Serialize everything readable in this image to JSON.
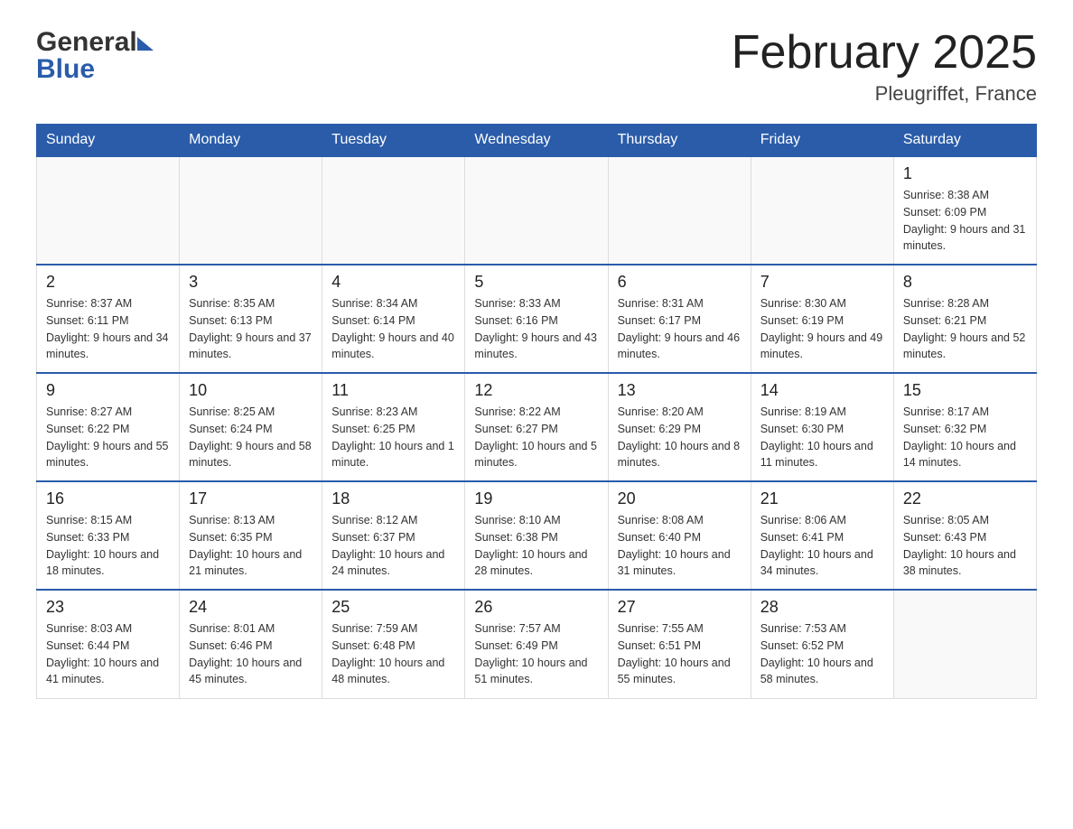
{
  "header": {
    "logo_general": "General",
    "logo_blue": "Blue",
    "month_title": "February 2025",
    "location": "Pleugriffet, France"
  },
  "days_of_week": [
    "Sunday",
    "Monday",
    "Tuesday",
    "Wednesday",
    "Thursday",
    "Friday",
    "Saturday"
  ],
  "weeks": [
    [
      {
        "day": "",
        "info": ""
      },
      {
        "day": "",
        "info": ""
      },
      {
        "day": "",
        "info": ""
      },
      {
        "day": "",
        "info": ""
      },
      {
        "day": "",
        "info": ""
      },
      {
        "day": "",
        "info": ""
      },
      {
        "day": "1",
        "info": "Sunrise: 8:38 AM\nSunset: 6:09 PM\nDaylight: 9 hours and 31 minutes."
      }
    ],
    [
      {
        "day": "2",
        "info": "Sunrise: 8:37 AM\nSunset: 6:11 PM\nDaylight: 9 hours and 34 minutes."
      },
      {
        "day": "3",
        "info": "Sunrise: 8:35 AM\nSunset: 6:13 PM\nDaylight: 9 hours and 37 minutes."
      },
      {
        "day": "4",
        "info": "Sunrise: 8:34 AM\nSunset: 6:14 PM\nDaylight: 9 hours and 40 minutes."
      },
      {
        "day": "5",
        "info": "Sunrise: 8:33 AM\nSunset: 6:16 PM\nDaylight: 9 hours and 43 minutes."
      },
      {
        "day": "6",
        "info": "Sunrise: 8:31 AM\nSunset: 6:17 PM\nDaylight: 9 hours and 46 minutes."
      },
      {
        "day": "7",
        "info": "Sunrise: 8:30 AM\nSunset: 6:19 PM\nDaylight: 9 hours and 49 minutes."
      },
      {
        "day": "8",
        "info": "Sunrise: 8:28 AM\nSunset: 6:21 PM\nDaylight: 9 hours and 52 minutes."
      }
    ],
    [
      {
        "day": "9",
        "info": "Sunrise: 8:27 AM\nSunset: 6:22 PM\nDaylight: 9 hours and 55 minutes."
      },
      {
        "day": "10",
        "info": "Sunrise: 8:25 AM\nSunset: 6:24 PM\nDaylight: 9 hours and 58 minutes."
      },
      {
        "day": "11",
        "info": "Sunrise: 8:23 AM\nSunset: 6:25 PM\nDaylight: 10 hours and 1 minute."
      },
      {
        "day": "12",
        "info": "Sunrise: 8:22 AM\nSunset: 6:27 PM\nDaylight: 10 hours and 5 minutes."
      },
      {
        "day": "13",
        "info": "Sunrise: 8:20 AM\nSunset: 6:29 PM\nDaylight: 10 hours and 8 minutes."
      },
      {
        "day": "14",
        "info": "Sunrise: 8:19 AM\nSunset: 6:30 PM\nDaylight: 10 hours and 11 minutes."
      },
      {
        "day": "15",
        "info": "Sunrise: 8:17 AM\nSunset: 6:32 PM\nDaylight: 10 hours and 14 minutes."
      }
    ],
    [
      {
        "day": "16",
        "info": "Sunrise: 8:15 AM\nSunset: 6:33 PM\nDaylight: 10 hours and 18 minutes."
      },
      {
        "day": "17",
        "info": "Sunrise: 8:13 AM\nSunset: 6:35 PM\nDaylight: 10 hours and 21 minutes."
      },
      {
        "day": "18",
        "info": "Sunrise: 8:12 AM\nSunset: 6:37 PM\nDaylight: 10 hours and 24 minutes."
      },
      {
        "day": "19",
        "info": "Sunrise: 8:10 AM\nSunset: 6:38 PM\nDaylight: 10 hours and 28 minutes."
      },
      {
        "day": "20",
        "info": "Sunrise: 8:08 AM\nSunset: 6:40 PM\nDaylight: 10 hours and 31 minutes."
      },
      {
        "day": "21",
        "info": "Sunrise: 8:06 AM\nSunset: 6:41 PM\nDaylight: 10 hours and 34 minutes."
      },
      {
        "day": "22",
        "info": "Sunrise: 8:05 AM\nSunset: 6:43 PM\nDaylight: 10 hours and 38 minutes."
      }
    ],
    [
      {
        "day": "23",
        "info": "Sunrise: 8:03 AM\nSunset: 6:44 PM\nDaylight: 10 hours and 41 minutes."
      },
      {
        "day": "24",
        "info": "Sunrise: 8:01 AM\nSunset: 6:46 PM\nDaylight: 10 hours and 45 minutes."
      },
      {
        "day": "25",
        "info": "Sunrise: 7:59 AM\nSunset: 6:48 PM\nDaylight: 10 hours and 48 minutes."
      },
      {
        "day": "26",
        "info": "Sunrise: 7:57 AM\nSunset: 6:49 PM\nDaylight: 10 hours and 51 minutes."
      },
      {
        "day": "27",
        "info": "Sunrise: 7:55 AM\nSunset: 6:51 PM\nDaylight: 10 hours and 55 minutes."
      },
      {
        "day": "28",
        "info": "Sunrise: 7:53 AM\nSunset: 6:52 PM\nDaylight: 10 hours and 58 minutes."
      },
      {
        "day": "",
        "info": ""
      }
    ]
  ]
}
